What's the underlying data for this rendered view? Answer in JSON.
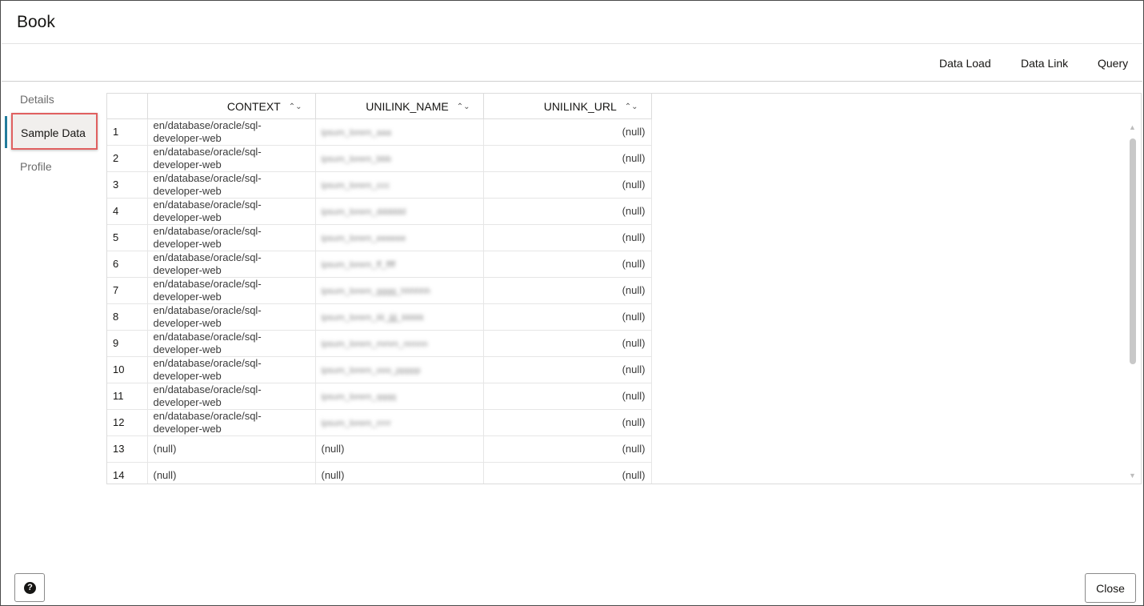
{
  "dialog": {
    "title": "Book"
  },
  "toolbar": {
    "data_load": "Data Load",
    "data_link": "Data Link",
    "query": "Query"
  },
  "sidebar": {
    "items": [
      {
        "label": "Details"
      },
      {
        "label": "Sample Data"
      },
      {
        "label": "Profile"
      }
    ],
    "selected": "Sample Data"
  },
  "grid": {
    "columns": [
      "CONTEXT",
      "UNILINK_NAME",
      "UNILINK_URL"
    ],
    "rows": [
      {
        "num": "1",
        "context": "en/database/oracle/sql-developer-web",
        "name": "ipsum_lorem_aaa",
        "url": "(null)"
      },
      {
        "num": "2",
        "context": "en/database/oracle/sql-developer-web",
        "name": "ipsum_lorem_bbb",
        "url": "(null)"
      },
      {
        "num": "3",
        "context": "en/database/oracle/sql-developer-web",
        "name": "ipsum_lorem_ccc",
        "url": "(null)"
      },
      {
        "num": "4",
        "context": "en/database/oracle/sql-developer-web",
        "name": "ipsum_lorem_dddddd",
        "url": "(null)"
      },
      {
        "num": "5",
        "context": "en/database/oracle/sql-developer-web",
        "name": "ipsum_lorem_eeeeee",
        "url": "(null)"
      },
      {
        "num": "6",
        "context": "en/database/oracle/sql-developer-web",
        "name": "ipsum_lorem_ff_ffff",
        "url": "(null)"
      },
      {
        "num": "7",
        "context": "en/database/oracle/sql-developer-web",
        "name": "ipsum_lorem_gggg_hhhhhh",
        "url": "(null)"
      },
      {
        "num": "8",
        "context": "en/database/oracle/sql-developer-web",
        "name": "ipsum_lorem_iiii_jjjj_kkkkk",
        "url": "(null)"
      },
      {
        "num": "9",
        "context": "en/database/oracle/sql-developer-web",
        "name": "ipsum_lorem_mmm_nnnnn",
        "url": "(null)"
      },
      {
        "num": "10",
        "context": "en/database/oracle/sql-developer-web",
        "name": "ipsum_lorem_ooo_ppppp",
        "url": "(null)"
      },
      {
        "num": "11",
        "context": "en/database/oracle/sql-developer-web",
        "name": "ipsum_lorem_qqqq",
        "url": "(null)"
      },
      {
        "num": "12",
        "context": "en/database/oracle/sql-developer-web",
        "name": "ipsum_lorem_rrrrr",
        "url": "(null)"
      },
      {
        "num": "13",
        "context": "(null)",
        "name": "(null)",
        "url": "(null)"
      },
      {
        "num": "14",
        "context": "(null)",
        "name": "(null)",
        "url": "(null)"
      }
    ]
  },
  "footer": {
    "help_icon": "?",
    "close_label": "Close"
  }
}
